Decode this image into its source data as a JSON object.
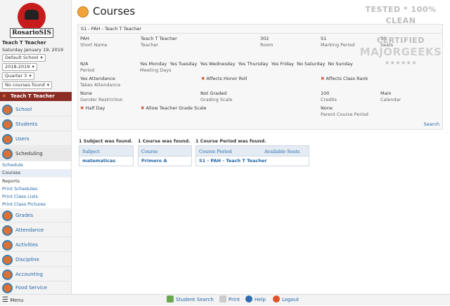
{
  "app": {
    "logo_text": "RosarioSIS",
    "user_name": "Teach T Teacher",
    "date": "Saturday January 19, 2019",
    "school_select": "Default School",
    "year_select": "2018-2019",
    "quarter_select": "Quarter 3",
    "course_select": "No courses found",
    "current_user": "Teach T Teacher"
  },
  "menu": [
    "School",
    "Students",
    "Users",
    "Scheduling",
    "Grades",
    "Attendance",
    "Activities",
    "Discipline",
    "Accounting",
    "Food Service"
  ],
  "submenu": [
    "Schedule",
    "Courses",
    "Reports",
    "Print Schedules",
    "Print Class Lists",
    "Print Class Pictures"
  ],
  "page": {
    "title": "Courses"
  },
  "period": {
    "header": "S1 - PAH - Teach T Teacher",
    "short_name": "PAH",
    "short_name_lbl": "Short Name",
    "teacher": "Teach T Teacher",
    "teacher_lbl": "Teacher",
    "room": "302",
    "room_lbl": "Room",
    "mp": "S1",
    "mp_lbl": "Marking Period",
    "seats": "30",
    "seats_lbl": "Seats",
    "period": "N/A",
    "period_lbl": "Period",
    "days": "Yes Monday  Yes Tuesday  Yes Wednesday  Yes Thursday  Yes Friday  No Saturday  No Sunday",
    "days_lbl": "Meeting Days",
    "attendance": "Yes Attendance",
    "attendance_lbl": "Takes Attendance",
    "honor": "Affects Honor Roll",
    "rank": "Affects Class Rank",
    "gender": "None",
    "gender_lbl": "Gender Restriction",
    "grading": "Not Graded",
    "grading_lbl": "Grading Scale",
    "credits": "100",
    "credits_lbl": "Credits",
    "calendar": "Main",
    "calendar_lbl": "Calendar",
    "halfday": "Half Day",
    "allow": "Allow Teacher Grade Scale",
    "parent": "None",
    "parent_lbl": "Parent Course Period",
    "search": "Search"
  },
  "tables": {
    "subj_count": "1 Subject was found.",
    "subj_h": "Subject",
    "subj_r": "matematicas",
    "course_count": "1 Course was found.",
    "course_h": "Course",
    "course_r": "Primero A",
    "cp_count": "1 Course Period was found.",
    "cp_h": "Course Period",
    "cp_h2": "Available Seats",
    "cp_r": "S1 - PAH - Teach T Teacher"
  },
  "footer": {
    "menu": "Menu",
    "student_search": "Student Search",
    "print": "Print",
    "help": "Help",
    "logout": "Logout"
  },
  "watermark": {
    "l1": "TESTED * 100% CLEAN",
    "l2": "CERTIFIED",
    "l3": "MAJORGEEKS",
    "l4": "★★★★★★"
  }
}
